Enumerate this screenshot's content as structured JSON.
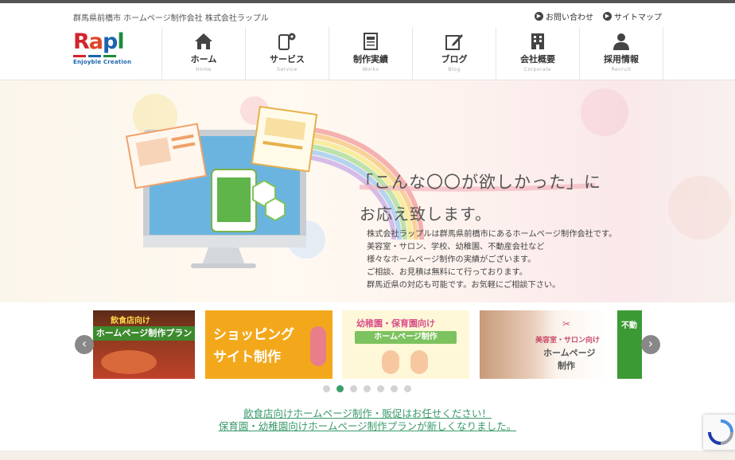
{
  "header": {
    "tagline": "群馬県前橋市 ホームページ制作会社 株式会社ラップル",
    "top_links": [
      {
        "label": "お問い合わせ",
        "icon": "arrow-circle-icon"
      },
      {
        "label": "サイトマップ",
        "icon": "arrow-circle-icon"
      }
    ],
    "logo": {
      "word": [
        "R",
        "a",
        "p",
        "l"
      ],
      "sub": "Enjoyble Creation",
      "colors": [
        "#d3232b",
        "#1a64b0",
        "#1e8a3c"
      ]
    }
  },
  "nav": [
    {
      "label": "ホーム",
      "sub": "Home",
      "icon": "home-icon",
      "active": true
    },
    {
      "label": "サービス",
      "sub": "Service",
      "icon": "device-gear-icon",
      "active": false
    },
    {
      "label": "制作実績",
      "sub": "Works",
      "icon": "document-icon",
      "active": false
    },
    {
      "label": "ブログ",
      "sub": "Blog",
      "icon": "pencil-note-icon",
      "active": false
    },
    {
      "label": "会社概要",
      "sub": "Corporate",
      "icon": "building-icon",
      "active": false
    },
    {
      "label": "採用情報",
      "sub": "Recruit",
      "icon": "person-icon",
      "active": false
    }
  ],
  "hero": {
    "heading_open": "「",
    "heading_highlight": "こんな〇〇が欲しかった",
    "heading_close": "」",
    "heading_tail": "に",
    "subheading": "お応え致します。",
    "body_lines": [
      "株式会社ラップルは群馬県前橋市にあるホームページ制作会社です。",
      "美容室・サロン、学校、幼稚園、不動産会社など",
      "様々なホームページ制作の実績がございます。",
      "ご相談、お見積は無料にて行っております。",
      "群馬近県の対応も可能です。お気軽にご相談下さい。"
    ]
  },
  "carousel": {
    "slides": [
      {
        "line1": "飲食店向け",
        "line2": "ホームページ制作プラン"
      },
      {
        "line1": "ショッピング",
        "line2": "サイト制作"
      },
      {
        "line1": "幼稚園・保育園向け",
        "line2": "ホームページ制作"
      },
      {
        "line1": "美容室・サロン向け",
        "line2": "ホームページ",
        "line3": "制作"
      },
      {
        "line1": "不動"
      }
    ],
    "prev": "‹",
    "next": "›",
    "dot_count": 7,
    "active_dot": 1
  },
  "news": [
    "飲食店向けホームページ制作・販促はお任せください！",
    "保育園・幼稚園向けホームページ制作プランが新しくなりました。"
  ],
  "colors": {
    "accent": "#3aaa64",
    "link": "#3a9a6a"
  }
}
